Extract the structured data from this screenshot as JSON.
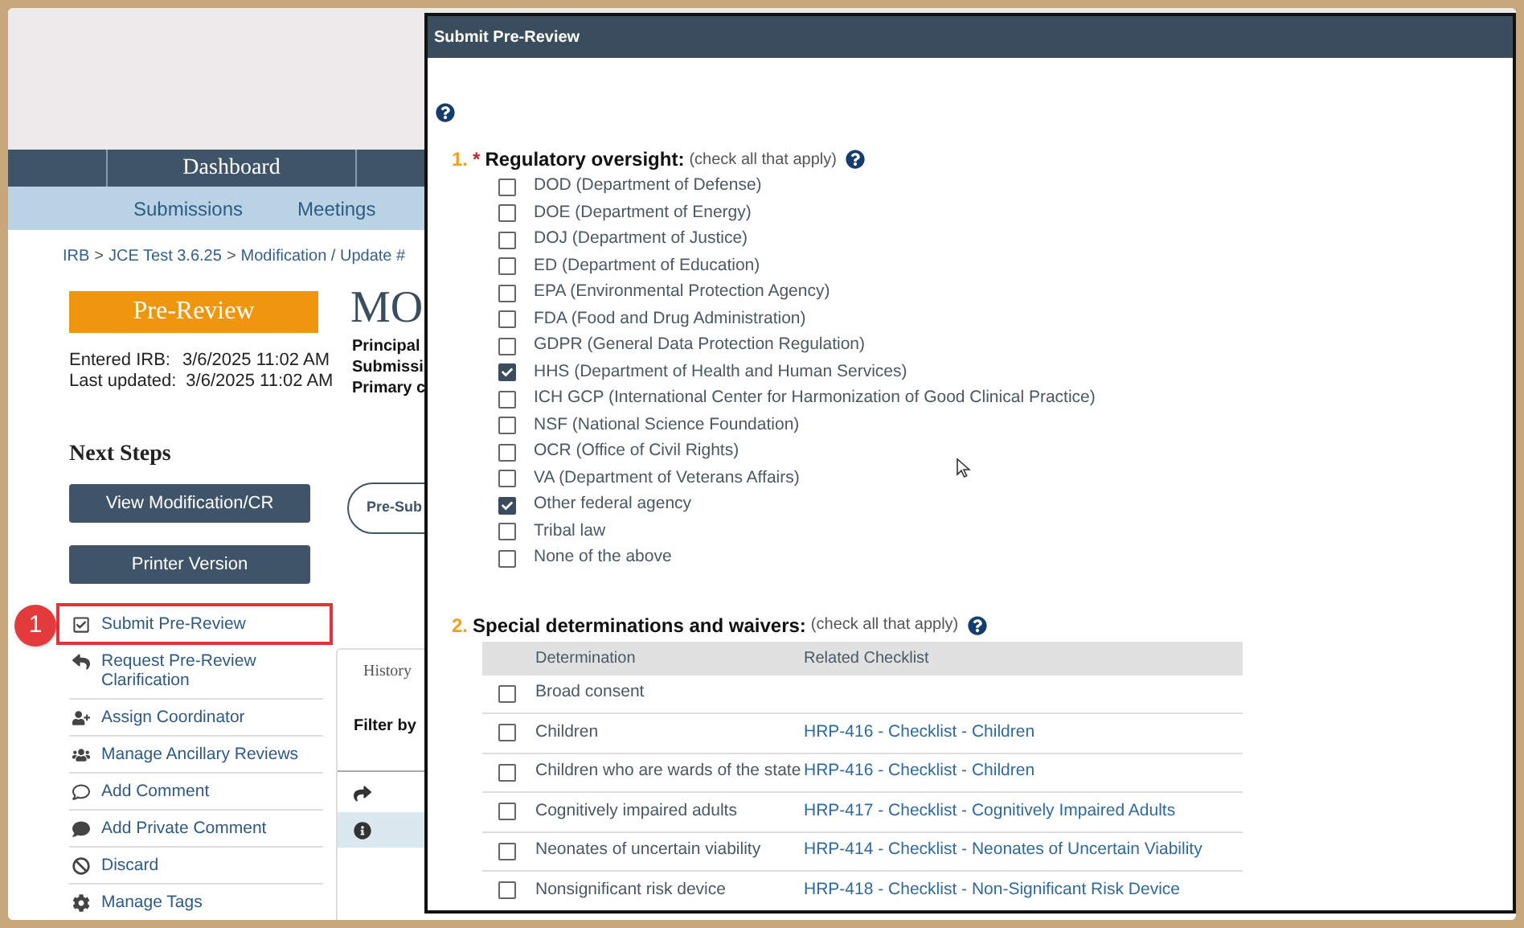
{
  "nav": {
    "primary": [
      {
        "label": "Dashboard"
      }
    ],
    "secondary": [
      {
        "label": "Submissions"
      },
      {
        "label": "Meetings"
      }
    ]
  },
  "breadcrumb": {
    "separator": ">",
    "items": [
      "IRB",
      "JCE Test 3.6.25",
      "Modification / Update #"
    ]
  },
  "state": "Pre-Review",
  "dates": [
    {
      "label": "Entered IRB:",
      "value": "3/6/2025 11:02 AM"
    },
    {
      "label": "Last updated:",
      "value": "3/6/2025 11:02 AM"
    }
  ],
  "heading": "MO",
  "fields": [
    "Principal",
    "Submissi",
    "Primary c"
  ],
  "pill": "Pre-Sub",
  "next_steps": {
    "title": "Next Steps",
    "buttons": [
      "View Modification/CR",
      "Printer Version"
    ],
    "actions": [
      {
        "kind": "submit",
        "label": "Submit Pre-Review",
        "highlighted": true,
        "callout": "1"
      },
      {
        "kind": "reply",
        "label": "Request Pre-Review Clarification",
        "highlighted": false
      },
      {
        "kind": "assign",
        "label": "Assign Coordinator",
        "highlighted": false
      },
      {
        "kind": "group",
        "label": "Manage Ancillary Reviews",
        "highlighted": false
      },
      {
        "kind": "comment",
        "label": "Add Comment",
        "highlighted": false
      },
      {
        "kind": "private",
        "label": "Add Private Comment",
        "highlighted": false
      },
      {
        "kind": "discard",
        "label": "Discard",
        "highlighted": false
      },
      {
        "kind": "tags",
        "label": "Manage Tags",
        "highlighted": false
      }
    ]
  },
  "history": {
    "tab": "History",
    "filter_label": "Filter by"
  },
  "dialog": {
    "title": "Submit Pre-Review",
    "questions": [
      {
        "kind": "checklist",
        "number": "1.",
        "required_mark": "*",
        "label": "Regulatory oversight:",
        "hint": "(check all that apply)",
        "options": [
          {
            "label": "DOD (Department of Defense)",
            "checked": false
          },
          {
            "label": "DOE (Department of Energy)",
            "checked": false
          },
          {
            "label": "DOJ (Department of Justice)",
            "checked": false
          },
          {
            "label": "ED (Department of Education)",
            "checked": false
          },
          {
            "label": "EPA (Environmental Protection Agency)",
            "checked": false
          },
          {
            "label": "FDA (Food and Drug Administration)",
            "checked": false
          },
          {
            "label": "GDPR (General Data Protection Regulation)",
            "checked": false
          },
          {
            "label": "HHS (Department of Health and Human Services)",
            "checked": true
          },
          {
            "label": "ICH GCP (International Center for Harmonization of Good Clinical Practice)",
            "checked": false
          },
          {
            "label": "NSF (National Science Foundation)",
            "checked": false
          },
          {
            "label": "OCR (Office of Civil Rights)",
            "checked": false
          },
          {
            "label": "VA (Department of Veterans Affairs)",
            "checked": false
          },
          {
            "label": "Other federal agency",
            "checked": true
          },
          {
            "label": "Tribal law",
            "checked": false
          },
          {
            "label": "None of the above",
            "checked": false
          }
        ]
      },
      {
        "kind": "table",
        "number": "2.",
        "label": "Special determinations and waivers:",
        "hint": "(check all that apply)",
        "columns": [
          "Determination",
          "Related Checklist"
        ],
        "rows": [
          {
            "determination": "Broad consent",
            "checked": false
          },
          {
            "determination": "Children",
            "checklist": "HRP-416 - Checklist - Children",
            "checked": false
          },
          {
            "determination": "Children who are wards of the state",
            "checklist": "HRP-416 - Checklist - Children",
            "checked": false
          },
          {
            "determination": "Cognitively impaired adults",
            "checklist": "HRP-417 - Checklist - Cognitively Impaired Adults",
            "checked": false
          },
          {
            "determination": "Neonates of uncertain viability",
            "checklist": "HRP-414 - Checklist - Neonates of Uncertain Viability",
            "checked": false
          },
          {
            "determination": "Nonsignificant risk device",
            "checklist": "HRP-418 - Checklist - Non-Significant Risk Device",
            "checked": false
          }
        ]
      }
    ]
  }
}
